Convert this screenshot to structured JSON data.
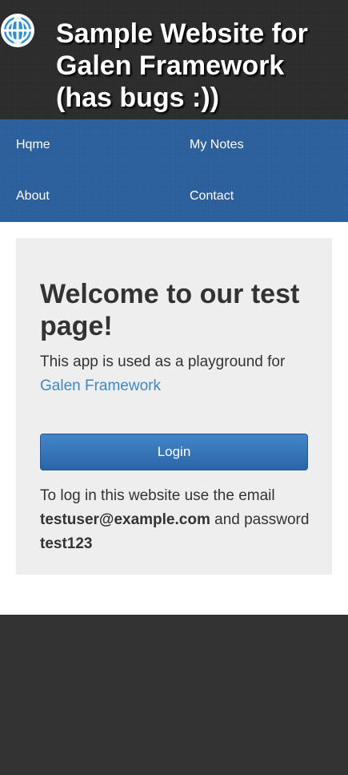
{
  "header": {
    "logo_icon": "globe-icon",
    "title": "Sample Website for Galen Framework (has bugs :))"
  },
  "nav": {
    "items": [
      {
        "label": "Hqme"
      },
      {
        "label": "My Notes"
      },
      {
        "label": "About"
      },
      {
        "label": "Contact"
      }
    ]
  },
  "main": {
    "heading": "Welcome to our test page!",
    "intro_text": "This app is used as a playground for",
    "intro_link": "Galen Framework",
    "login_button": "Login",
    "login_info": {
      "prefix": "To log in this website use the email",
      "email": "testuser@example.com",
      "middle": "and password",
      "password": "test123"
    }
  },
  "colors": {
    "header_bg": "#2b2b2b",
    "nav_bg": "#2a5e9b",
    "panel_bg": "#eeeeee",
    "link": "#3f88c8",
    "button": "#2f6fb3",
    "footer_bg": "#333333"
  }
}
